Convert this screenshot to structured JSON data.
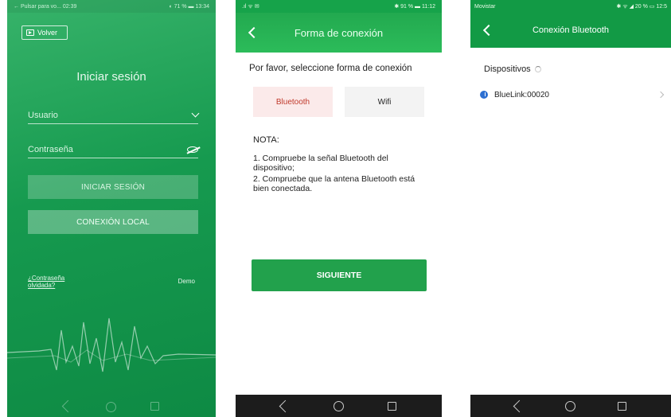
{
  "screen_login": {
    "status_bar": {
      "left": "← Pulsar para vo... 02:39",
      "right": "◐ 71 % ▬ 13:34"
    },
    "back_label": "Volver",
    "title": "Iniciar sesión",
    "username_placeholder": "Usuario",
    "password_placeholder": "Contraseña",
    "login_button": "INICIAR SESIÓN",
    "local_button": "CONEXIÓN LOCAL",
    "forgot_link": "¿Contraseña olvidada?",
    "demo_link": "Demo"
  },
  "screen_connection": {
    "status_bar": {
      "left": ".ıl ᯤ ✉",
      "right": "✱ 91 % ▬ 11:12"
    },
    "title": "Forma de conexión",
    "prompt": "Por favor, seleccione forma de conexión",
    "options": [
      {
        "label": "Bluetooth"
      },
      {
        "label": "Wifi"
      }
    ],
    "note_title": "NOTA:",
    "notes": [
      "1. Compruebe la señal Bluetooth del dispositivo;",
      "2. Compruebe que la antena Bluetooth está bien conectada."
    ],
    "next_button": "SIGUIENTE"
  },
  "screen_bluetooth": {
    "status_bar": {
      "left": "Movistar",
      "right": "✱ ᯤ ◢ 20 % ▭ 12:5"
    },
    "title": "Conexión Bluetooth",
    "devices_header": "Dispositivos",
    "devices": [
      {
        "name": "BlueLink:00020"
      }
    ]
  },
  "colors": {
    "green_primary": "#16a34a",
    "green_button": "#22a14c",
    "bluetooth_accent": "#c0392b",
    "bluetooth_icon": "#2c6fd1"
  }
}
